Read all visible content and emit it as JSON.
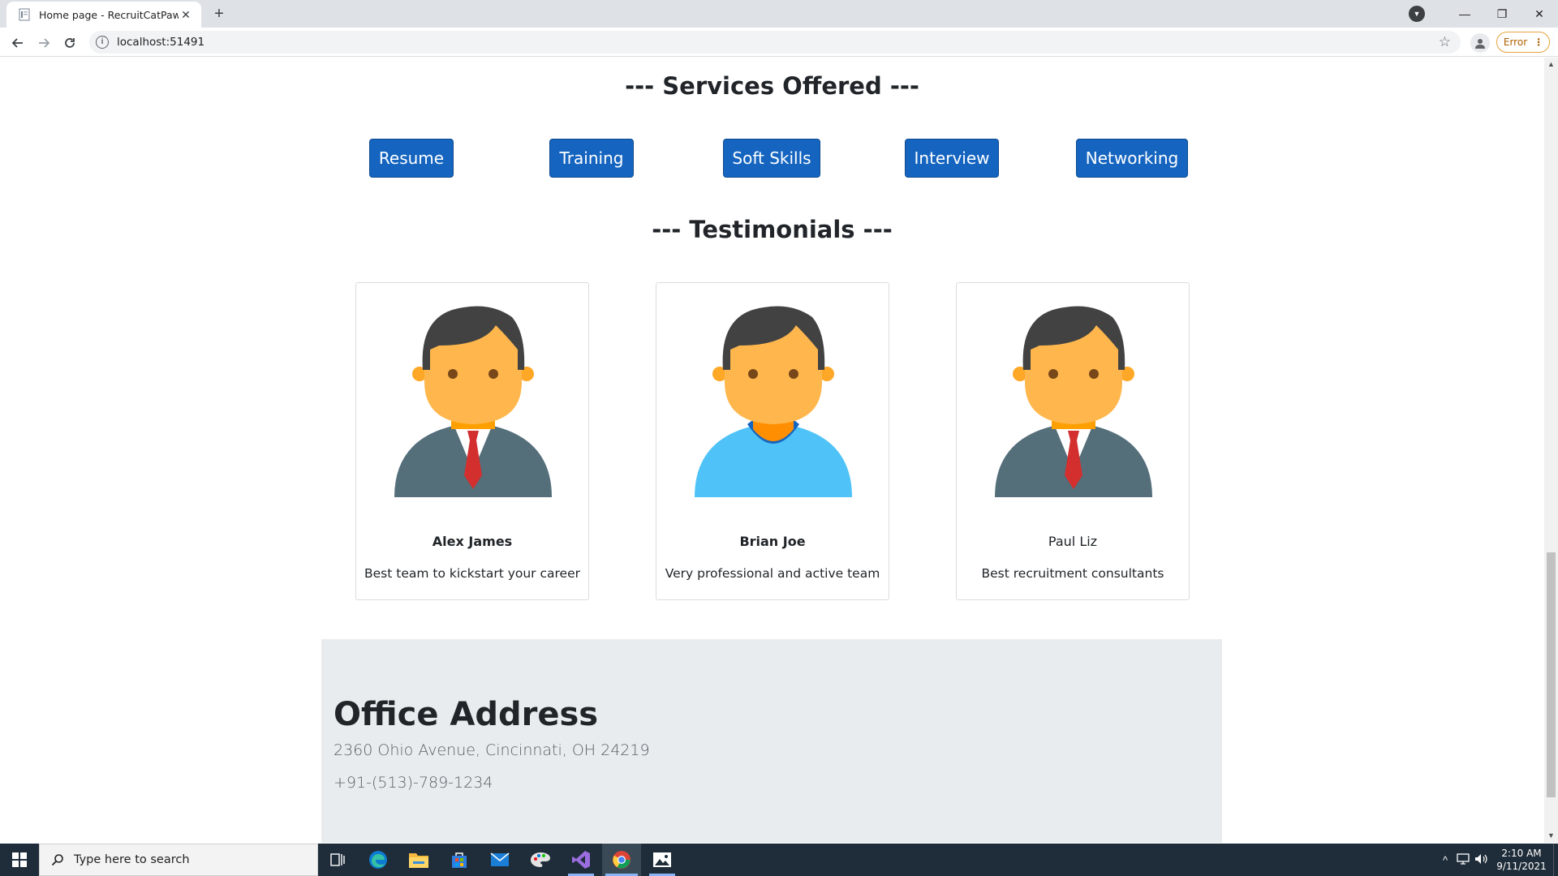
{
  "browser": {
    "tab_title": "Home page - RecruitCatPawarah",
    "close_glyph": "✕",
    "new_tab_glyph": "+",
    "url": "localhost:51491",
    "info_glyph": "i",
    "star_glyph": "☆",
    "error_label": "Error",
    "menu_glyph": "⋮",
    "tab_search_glyph": "▼",
    "minimize_glyph": "—",
    "restore_glyph": "❐",
    "window_close_glyph": "✕"
  },
  "services": {
    "title": "--- Services Offered ---",
    "buttons": [
      "Resume",
      "Training",
      "Soft Skills",
      "Interview",
      "Networking"
    ]
  },
  "testimonials": {
    "title": "--- Testimonials ---",
    "cards": [
      {
        "name": "Alex James",
        "text": "Best team to kickstart your career",
        "avatar": "businessman-avatar-icon"
      },
      {
        "name": "Brian Joe",
        "text": "Very professional and active team",
        "avatar": "casual-man-avatar-icon"
      },
      {
        "name": "Paul Liz",
        "text": "Best recruitment consultants",
        "avatar": "businessman-avatar-icon"
      }
    ]
  },
  "office": {
    "title": "Office Address",
    "address": "2360 Ohio Avenue, Cincinnati, OH 24219",
    "phone": "+91-(513)-789-1234"
  },
  "taskbar": {
    "search_placeholder": "Type here to search",
    "time": "2:10 AM",
    "date": "9/11/2021",
    "tray_chevron": "^"
  },
  "colors": {
    "service_button": "#1565c0",
    "address_panel": "#e9ecef",
    "taskbar": "#1f2d3a"
  }
}
